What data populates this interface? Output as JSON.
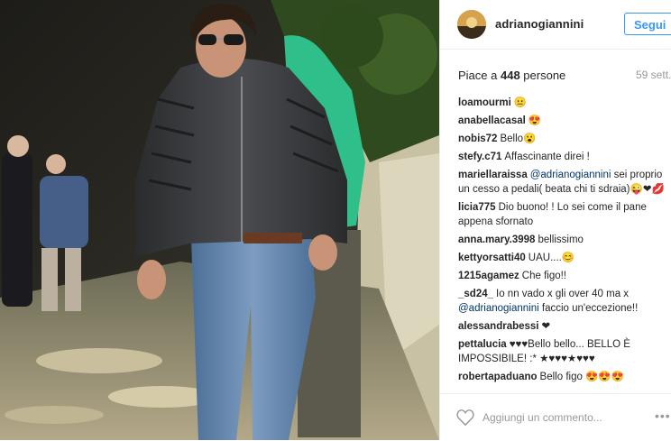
{
  "post": {
    "username": "adrianogiannini",
    "follow_label": "Segui",
    "likes_prefix": "Piace a ",
    "likes_count": "448",
    "likes_suffix": " persone",
    "time": "59 sett.",
    "add_comment_placeholder": "Aggiungi un commento...",
    "more_label": "•••"
  },
  "comments": [
    {
      "user": "loamourmi",
      "text": "😐"
    },
    {
      "user": "anabellacasal",
      "text": "😍"
    },
    {
      "user": "nobis72",
      "text": "Bello😮"
    },
    {
      "user": "stefy.c71",
      "text": "Affascinante direi !"
    },
    {
      "user": "mariellaraissa",
      "mention": "@adrianogiannini",
      "text": " sei proprio un cesso a pedali( beata chi ti sdraia)😜❤💋"
    },
    {
      "user": "licia775",
      "text": "Dio buono! ! Lo sei come il pane appena sfornato"
    },
    {
      "user": "anna.mary.3998",
      "text": "bellissimo"
    },
    {
      "user": "kettyorsatti40",
      "text": "UAU....😊"
    },
    {
      "user": "1215agamez",
      "text": "Che figo!!"
    },
    {
      "user": "_sd24_",
      "text": "Io nn vado x gli over 40 ma x ",
      "mention2": "@adrianogiannini",
      "text2": " faccio un'eccezione!!"
    },
    {
      "user": "alessandrabessi",
      "text": "❤"
    },
    {
      "user": "pettalucia",
      "text": "♥♥♥Bello bello... BELLO È IMPOSSIBILE! :* ★♥♥♥★♥♥♥"
    },
    {
      "user": "robertapaduano",
      "text": "Bello figo 😍😍😍"
    }
  ]
}
